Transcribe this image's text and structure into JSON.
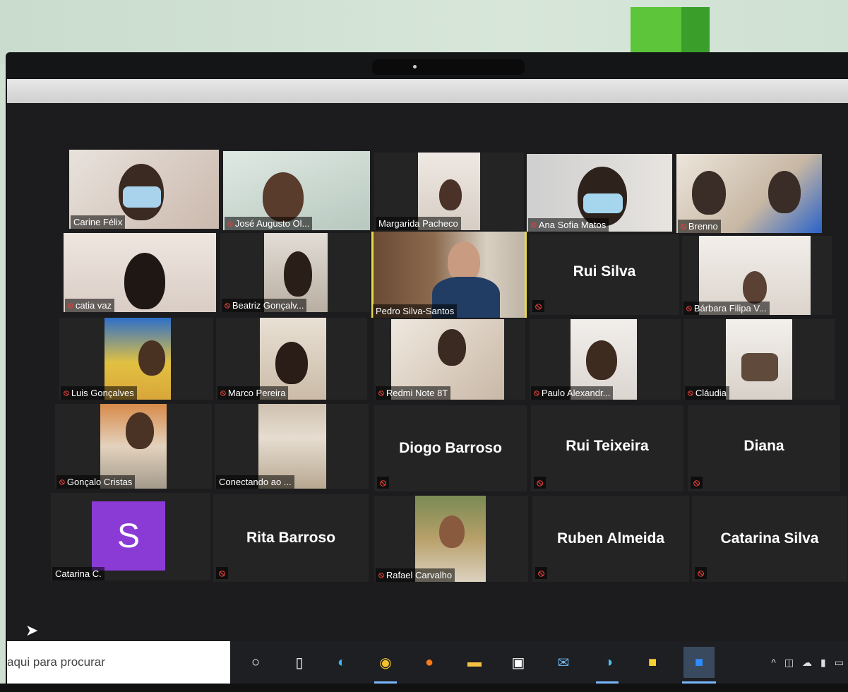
{
  "meeting": {
    "participants": [
      {
        "name": "Carine Félix",
        "muted": false
      },
      {
        "name": "José Augusto Ol...",
        "muted": true
      },
      {
        "name": "Margarida Pacheco",
        "muted": false
      },
      {
        "name": "Ana Sofia Matos",
        "muted": true
      },
      {
        "name": "Brenno",
        "muted": true
      },
      {
        "name": "catia vaz",
        "muted": true
      },
      {
        "name": "Beatriz Gonçalv...",
        "muted": true
      },
      {
        "name": "Pedro Silva-Santos",
        "muted": false,
        "active": true
      },
      {
        "name": "Rui Silva",
        "muted": true,
        "video": false
      },
      {
        "name": "Bárbara Filipa V...",
        "muted": true
      },
      {
        "name": "Luis Gonçalves",
        "muted": true
      },
      {
        "name": "Marco Pereira",
        "muted": true
      },
      {
        "name": "Redmi Note 8T",
        "muted": true
      },
      {
        "name": "Paulo Alexandr...",
        "muted": true
      },
      {
        "name": "Cláudia",
        "muted": true
      },
      {
        "name": "Gonçalo Cristas",
        "muted": true
      },
      {
        "name": "Conectando ao ...",
        "muted": false
      },
      {
        "name": "Diogo Barroso",
        "muted": true,
        "video": false
      },
      {
        "name": "Rui Teixeira",
        "muted": true,
        "video": false
      },
      {
        "name": "Diana",
        "muted": true,
        "video": false
      },
      {
        "name": "Catarina C.",
        "muted": false,
        "avatar": "S"
      },
      {
        "name": "Rita Barroso",
        "muted": true,
        "video": false
      },
      {
        "name": "Rafael Carvalho",
        "muted": true
      },
      {
        "name": "Ruben Almeida",
        "muted": true,
        "video": false
      },
      {
        "name": "Catarina Silva",
        "muted": true,
        "video": false
      }
    ]
  },
  "taskbar": {
    "search_placeholder": "aqui para procurar",
    "icons": [
      "cortana-icon",
      "task-view-icon",
      "edge-icon",
      "chrome-icon",
      "firefox-icon",
      "file-explorer-icon",
      "store-icon",
      "mail-icon",
      "edge-profile-icon",
      "sticky-notes-icon",
      "zoom-icon"
    ],
    "tray": [
      "chevron-up-icon",
      "meet-icon",
      "onedrive-icon",
      "microphone-icon",
      "battery-icon"
    ]
  },
  "colors": {
    "muted": "#e0403a",
    "active_speaker": "#e6d94a",
    "avatar": "#8a3bd6"
  }
}
